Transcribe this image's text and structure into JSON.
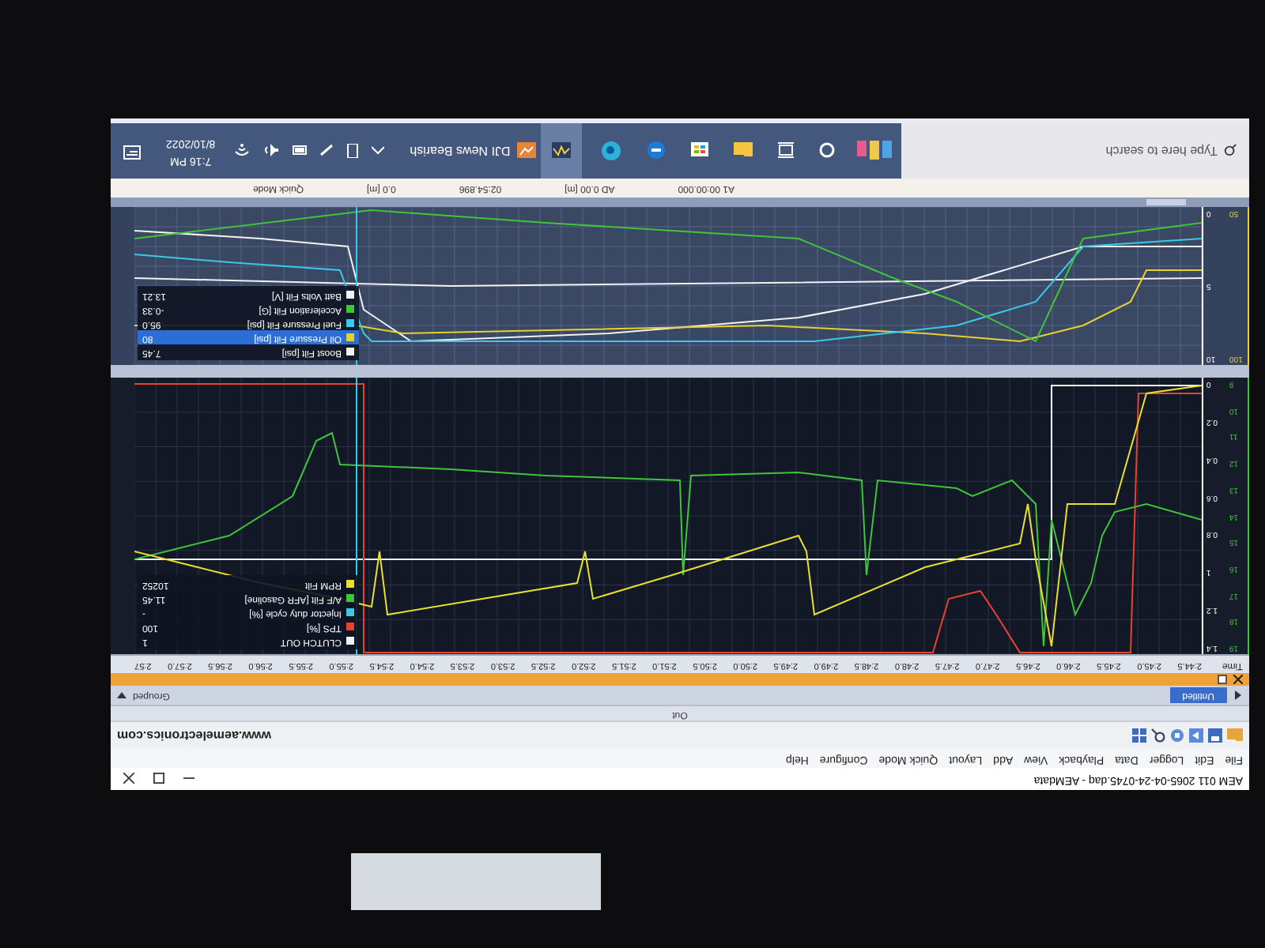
{
  "window": {
    "title": "AEM 011 2065-04-24-0745.daq - AEMdata"
  },
  "menu": [
    "File",
    "Edit",
    "Logger",
    "Data",
    "Playback",
    "View",
    "Add",
    "Layout",
    "Quick Mode",
    "Configure",
    "Help"
  ],
  "toolbar": {
    "url": "www.aemelectronics.com"
  },
  "output_bar": {
    "label": "Out"
  },
  "tabs": [
    {
      "label": "Untitled",
      "selected": true
    }
  ],
  "layout_mode": {
    "label": "Grouped"
  },
  "time_axis": {
    "title": "Time",
    "ticks": [
      "2:44.5",
      "2:45.0",
      "2:45.5",
      "2:46.0",
      "2:46.5",
      "2:47.0",
      "2:47.5",
      "2:48.0",
      "2:48.5",
      "2:49.0",
      "2:49.5",
      "2:50.0",
      "2:50.5",
      "2:51.0",
      "2:51.5",
      "2:52.0",
      "2:52.5",
      "2:53.0",
      "2:53.5",
      "2:54.0",
      "2:54.5",
      "2:55.0",
      "2:55.5",
      "2:56.0",
      "2:56.5",
      "2:57.0",
      "2:57"
    ]
  },
  "lower_chart": {
    "axis_1": [
      "1.4",
      "1.2",
      "1",
      "0.8",
      "0.6",
      "0.4",
      "0.2",
      "0"
    ],
    "axis_2": [
      "19",
      "18",
      "17",
      "16",
      "15",
      "14",
      "13",
      "12",
      "11",
      "10",
      "9"
    ],
    "legend": [
      {
        "name": "CLUTCH OUT",
        "value": "1",
        "color": "#f2f2f2"
      },
      {
        "name": "TPS [%]",
        "value": "100",
        "color": "#e8432e"
      },
      {
        "name": "Injector duty cycle [%]",
        "value": "-",
        "color": "#3cc8e8"
      },
      {
        "name": "A/F Filt [AFR Gasoline]",
        "value": "11.45",
        "color": "#3fc43a"
      },
      {
        "name": "RPM Filt",
        "value": "10252",
        "color": "#e8e030"
      }
    ]
  },
  "upper_chart": {
    "axis_1": [
      "10",
      "5",
      "0"
    ],
    "axis_2": [
      "100",
      "50"
    ],
    "legend": [
      {
        "name": "Boost Filt [psi]",
        "value": "7.45",
        "color": "#f2f2f2",
        "selected": false
      },
      {
        "name": "Oil Pressure Filt [psi]",
        "value": "80",
        "color": "#e8d030",
        "selected": true
      },
      {
        "name": "Fuel Pressure Filt [psi]",
        "value": "95.0",
        "color": "#3cc8e8",
        "selected": false
      },
      {
        "name": "Acceleration Filt [G]",
        "value": "-0.33",
        "color": "#3fc43a",
        "selected": false
      },
      {
        "name": "Batt Volts Filt [V]",
        "value": "13.21",
        "color": "#f2f2f2",
        "selected": false
      }
    ]
  },
  "status_bar": {
    "fields": [
      "A1 00:00.000",
      "AD 0.00 [m]",
      "02:54.896",
      "0.0 [m]",
      "Quick Mode"
    ]
  },
  "taskbar": {
    "search": {
      "placeholder": "Type here to search"
    },
    "weather": "DJI News Bearish",
    "time": "7:16 PM",
    "date": "8/10/2022"
  }
}
